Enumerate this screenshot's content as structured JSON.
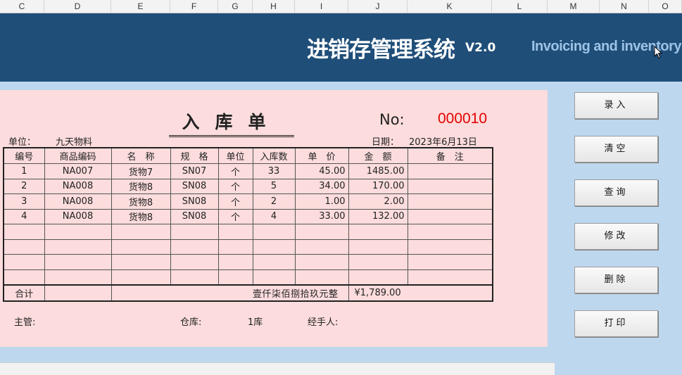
{
  "column_headers": [
    "C",
    "D",
    "E",
    "F",
    "G",
    "H",
    "I",
    "J",
    "K",
    "L",
    "M",
    "N",
    "O"
  ],
  "banner": {
    "title": "进销存管理系统",
    "version": "V2.0",
    "subtitle_en": "Invoicing and inventory ma"
  },
  "form": {
    "title": "入库单",
    "no_label": "No:",
    "no_value": "000010",
    "unit_label": "单位：",
    "unit_value": "九天物料",
    "date_label": "日期：",
    "date_value": "2023年6月13日",
    "headers": [
      "编号",
      "商品编码",
      "名　称",
      "规　格",
      "单位",
      "入库数",
      "单　价",
      "金　额",
      "备　注"
    ],
    "rows": [
      {
        "no": "1",
        "code": "NA007",
        "name": "货物7",
        "spec": "SN07",
        "unit": "个",
        "qty": "33",
        "price": "45.00",
        "amount": "1485.00",
        "note": ""
      },
      {
        "no": "2",
        "code": "NA008",
        "name": "货物8",
        "spec": "SN08",
        "unit": "个",
        "qty": "5",
        "price": "34.00",
        "amount": "170.00",
        "note": ""
      },
      {
        "no": "3",
        "code": "NA008",
        "name": "货物8",
        "spec": "SN08",
        "unit": "个",
        "qty": "2",
        "price": "1.00",
        "amount": "2.00",
        "note": ""
      },
      {
        "no": "4",
        "code": "NA008",
        "name": "货物8",
        "spec": "SN08",
        "unit": "个",
        "qty": "4",
        "price": "33.00",
        "amount": "132.00",
        "note": ""
      }
    ],
    "total_label": "合计",
    "total_words": "壹仟柒佰捌拾玖元整",
    "total_amount": "¥1,789.00",
    "supervisor_label": "主管:",
    "warehouse_label": "仓库:",
    "warehouse_value": "1库",
    "handler_label": "经手人:"
  },
  "buttons": {
    "entry": "录入",
    "clear": "清空",
    "query": "查询",
    "modify": "修改",
    "delete": "删除",
    "print": "打印"
  },
  "colors": {
    "banner_bg": "#1f4e79",
    "form_bg": "#fcdcdc",
    "page_bg": "#bdd7ee",
    "no_value": "#e60000"
  }
}
